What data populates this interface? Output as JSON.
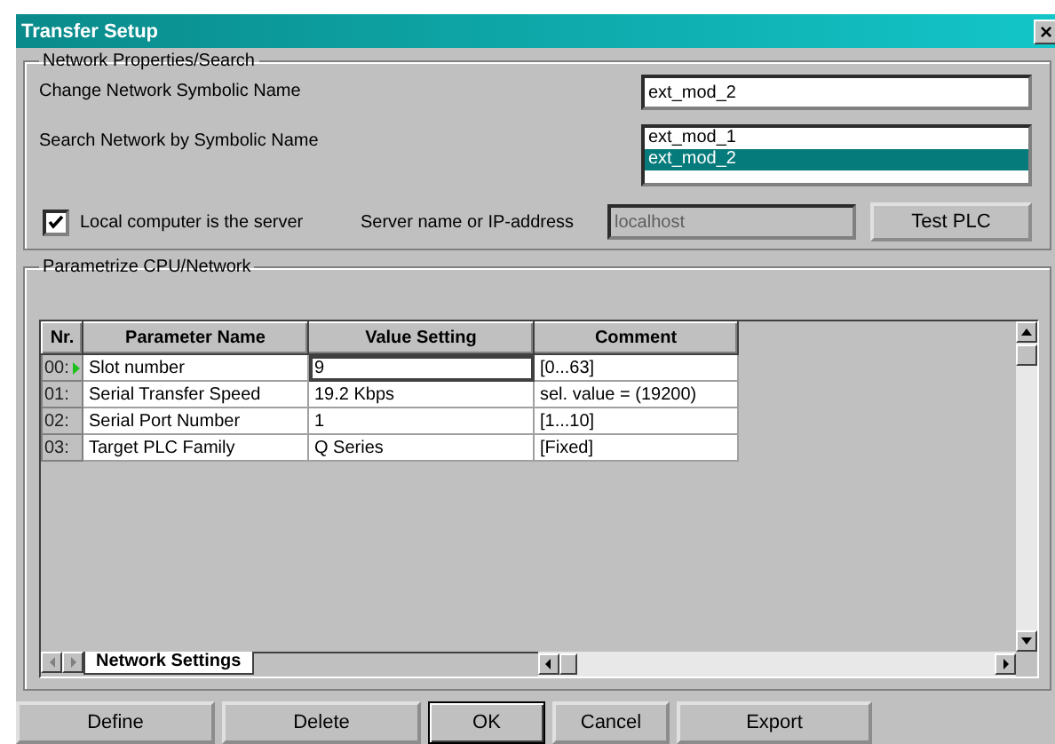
{
  "window": {
    "title": "Transfer Setup",
    "close": "×"
  },
  "network_group": {
    "title": "Network Properties/Search",
    "change_name": {
      "label": "Change Network Symbolic Name",
      "value": "ext_mod_2"
    },
    "search": {
      "label": "Search Network by Symbolic Name",
      "items": [
        {
          "label": "ext_mod_1",
          "selected": false
        },
        {
          "label": "ext_mod_2",
          "selected": true
        }
      ]
    },
    "local_server": {
      "label": "Local computer is the server",
      "checked": true
    },
    "server": {
      "label": "Server name or IP-address",
      "value": "localhost",
      "disabled": true
    },
    "test_button": "Test PLC"
  },
  "cpu_group": {
    "title": "Parametrize CPU/Network",
    "table": {
      "columns": [
        "Nr.",
        "Parameter Name",
        "Value Setting",
        "Comment"
      ],
      "rows": [
        {
          "nr": "00:",
          "name": "Slot number",
          "value": "9",
          "comment": "[0...63]",
          "selected": true
        },
        {
          "nr": "01:",
          "name": "Serial Transfer Speed",
          "value": "19.2 Kbps",
          "comment": "sel. value = (19200)",
          "selected": false
        },
        {
          "nr": "02:",
          "name": "Serial Port Number",
          "value": "1",
          "comment": "[1...10]",
          "selected": false
        },
        {
          "nr": "03:",
          "name": "Target PLC Family",
          "value": "Q Series",
          "comment": "[Fixed]",
          "selected": false
        }
      ]
    },
    "sheet_tabs": [
      {
        "label": "Network Settings",
        "selected": true
      }
    ]
  },
  "buttons": [
    {
      "label": "Define",
      "default": false
    },
    {
      "label": "Delete",
      "default": false
    },
    {
      "label": "OK",
      "default": true
    },
    {
      "label": "Cancel",
      "default": false
    },
    {
      "label": "Export",
      "default": false
    }
  ]
}
